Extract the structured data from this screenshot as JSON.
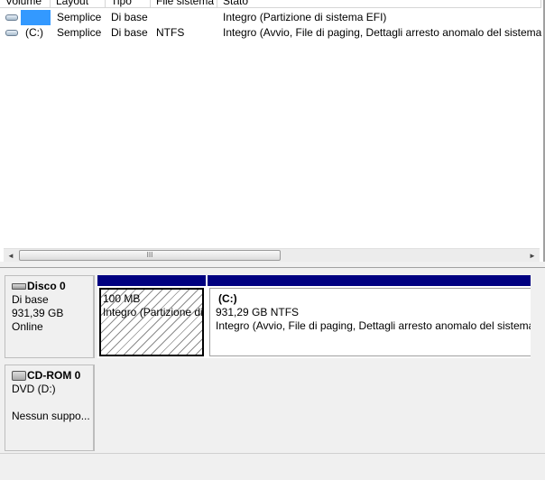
{
  "volume_list": {
    "headers": [
      "Volume",
      "Layout",
      "Tipo",
      "File sistema",
      "Stato"
    ],
    "rows": [
      {
        "volume": "",
        "layout": "Semplice",
        "tipo": "Di base",
        "fs": "",
        "stato": "Integro (Partizione di sistema EFI)"
      },
      {
        "volume": "(C:)",
        "layout": "Semplice",
        "tipo": "Di base",
        "fs": "NTFS",
        "stato": "Integro (Avvio, File di paging, Dettagli arresto anomalo del sistema, Pa"
      }
    ],
    "scroll_thumb_label": "III",
    "scroll_left_icon": "◄",
    "scroll_right_icon": "►"
  },
  "disks": [
    {
      "title": "Disco 0",
      "type": "Di base",
      "size": "931,39 GB",
      "status": "Online",
      "partitions": [
        {
          "name": "",
          "size": "100 MB",
          "status": "Integro (Partizione di sistema EFI)",
          "hatched": true
        },
        {
          "name": "(C:)",
          "size": "931,29 GB NTFS",
          "status": "Integro (Avvio, File di paging, Dettagli arresto anomalo del sistema"
        }
      ]
    },
    {
      "title": "CD-ROM 0",
      "type": "DVD (D:)",
      "status": "Nessun suppo..."
    }
  ],
  "colors": {
    "partition_bar": "#000080",
    "selection": "#3399ff"
  }
}
